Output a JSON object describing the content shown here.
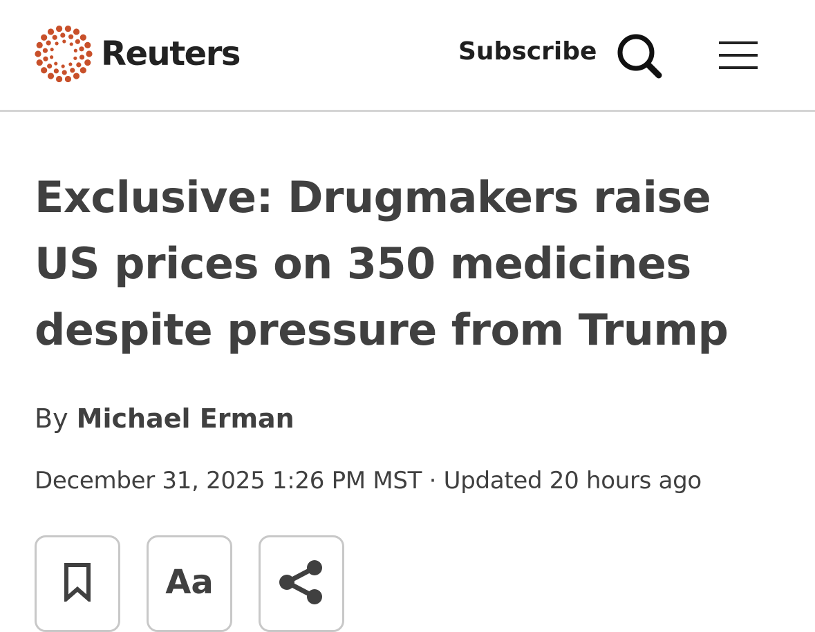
{
  "header": {
    "brand": "Reuters",
    "subscribe_label": "Subscribe",
    "search_icon": "search-icon",
    "menu_icon": "hamburger-menu-icon",
    "brand_color": "#c8502a"
  },
  "article": {
    "headline": "Exclusive: Drugmakers raise US prices on 350 medicines despite pressure from Trump",
    "byline_prefix": "By",
    "author": "Michael Erman",
    "date": "December 31, 2025 1:26 PM MST",
    "separator": "·",
    "updated": "Updated 20 hours ago"
  },
  "toolbar": {
    "bookmark_icon": "bookmark-icon",
    "text_size_label": "Aa",
    "share_icon": "share-icon"
  }
}
